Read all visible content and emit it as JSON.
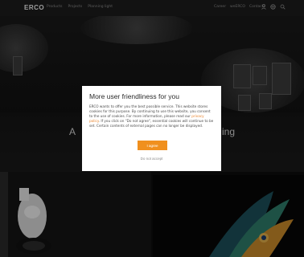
{
  "header": {
    "logo": "ERCO",
    "nav_main": [
      "Products",
      "Projects",
      "Planning light"
    ],
    "nav_util": [
      "Career",
      "weERCO",
      "Contacts"
    ],
    "icons": [
      "user-icon",
      "globe-icon",
      "search-icon"
    ]
  },
  "hero": {
    "title_left": "A",
    "title_right": "ing"
  },
  "modal": {
    "title": "More user friendliness for you",
    "body_1": "ERCO wants to offer you the best possible service. This website stores cookies for this purpose. By continuing to use this website, you consent to the use of cookies. For more information, please read our ",
    "policy_link": "privacy policy",
    "body_2": ". If you click on \"Do not agree\", essential cookies will continue to be set. Certain contents of external pages can no longer be displayed.",
    "agree_label": "I agree",
    "reject_label": "Do not accept"
  },
  "colors": {
    "accent": "#f0901e",
    "header_bg": "#1c1c1c"
  }
}
